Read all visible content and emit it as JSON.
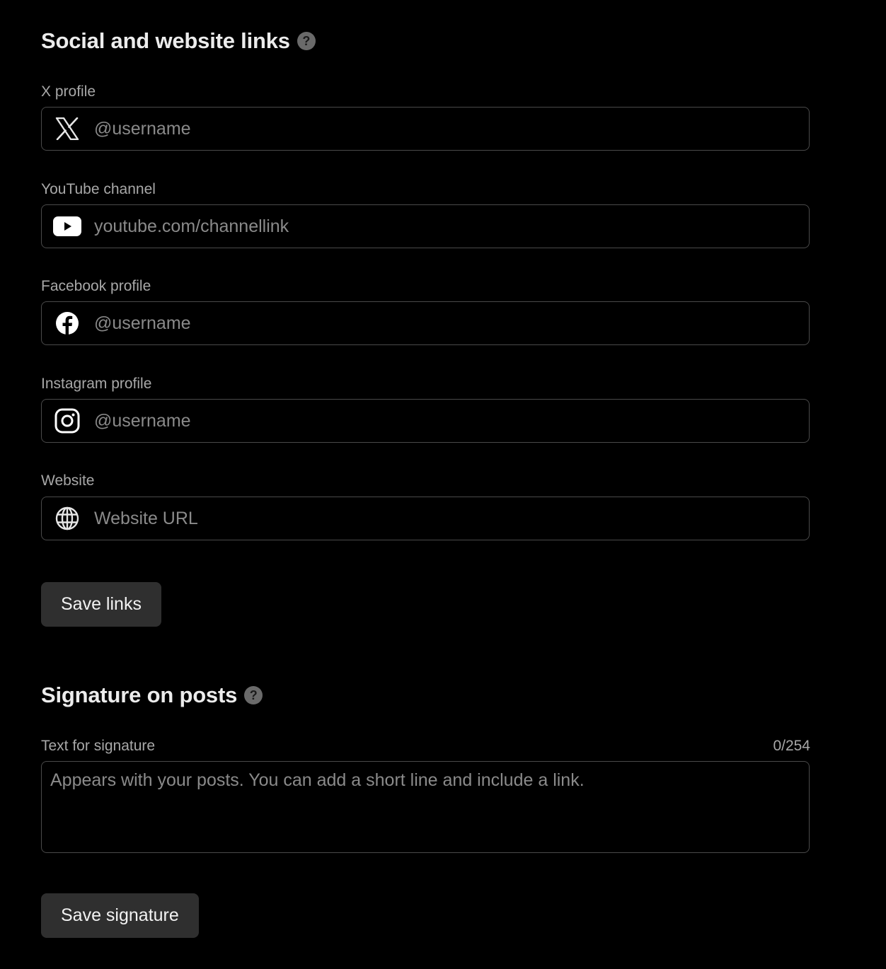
{
  "links_section": {
    "title": "Social and website links",
    "help_glyph": "?",
    "fields": [
      {
        "label": "X profile",
        "placeholder": "@username",
        "icon": "x-logo-icon",
        "value": ""
      },
      {
        "label": "YouTube channel",
        "placeholder": "youtube.com/channellink",
        "icon": "youtube-icon",
        "value": ""
      },
      {
        "label": "Facebook profile",
        "placeholder": "@username",
        "icon": "facebook-icon",
        "value": ""
      },
      {
        "label": "Instagram profile",
        "placeholder": "@username",
        "icon": "instagram-icon",
        "value": ""
      },
      {
        "label": "Website",
        "placeholder": "Website URL",
        "icon": "globe-icon",
        "value": ""
      }
    ],
    "save_label": "Save links"
  },
  "signature_section": {
    "title": "Signature on posts",
    "help_glyph": "?",
    "field_label": "Text for signature",
    "counter": "0/254",
    "placeholder": "Appears with your posts. You can add a short line and include a link.",
    "value": "",
    "save_label": "Save signature"
  },
  "colors": {
    "background": "#000000",
    "border": "#4a4a4a",
    "label": "#a8a8a8",
    "placeholder": "#8a8a8a",
    "button_bg": "#2f2f2f"
  }
}
